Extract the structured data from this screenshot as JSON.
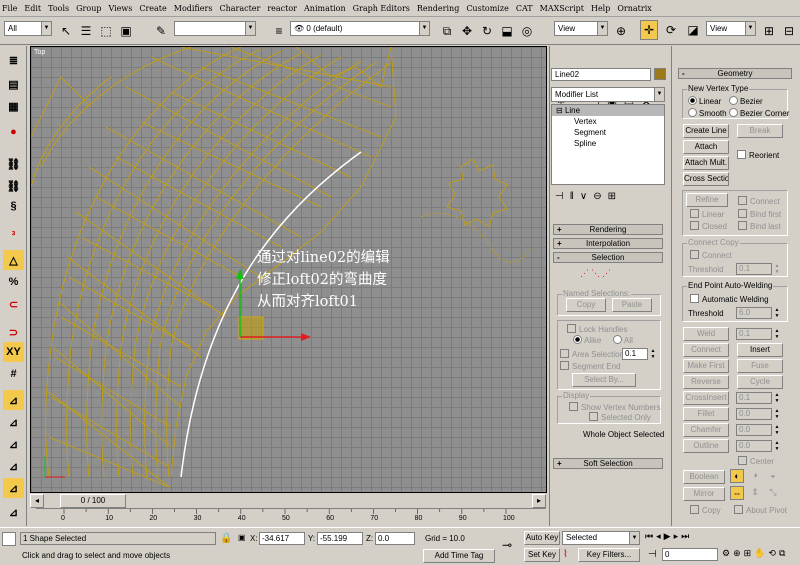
{
  "menu": [
    "File",
    "Edit",
    "Tools",
    "Group",
    "Views",
    "Create",
    "Modifiers",
    "Character",
    "reactor",
    "Animation",
    "Graph Editors",
    "Rendering",
    "Customize",
    "CAT",
    "MAXScript",
    "Help",
    "Ornatrix"
  ],
  "toolbar": {
    "selection_filter": "All",
    "named_selection": "",
    "layer": "0 (default)",
    "ref_coord": "View",
    "ref_coord2": "View",
    "icons": [
      "select-arrow-icon",
      "select-region-icon",
      "window-crossing-icon",
      "select-by-name-icon",
      "link-icon",
      "unlink-icon",
      "bind-icon",
      "layer-icon",
      "move-icon",
      "rotate-icon",
      "scale-icon",
      "pivot-icon",
      "mirror-icon",
      "align-icon"
    ]
  },
  "viewport": {
    "label": "Top",
    "annotation": [
      "通过对line02的编辑",
      "修正loft02的弯曲度",
      "从而对齐loft01"
    ]
  },
  "timeline": {
    "slider_label": "0 / 100",
    "ticks": [
      "0",
      "10",
      "20",
      "30",
      "40",
      "50",
      "60",
      "70",
      "80",
      "90",
      "100"
    ]
  },
  "status": {
    "selected": "1 Shape Selected",
    "prompt": "Click and drag to select and move objects",
    "x_label": "X:",
    "x": "-34.617",
    "y_label": "Y:",
    "y": "-55.199",
    "z_label": "Z:",
    "z": "0.0",
    "grid": "Grid = 10.0",
    "add_time_tag": "Add Time Tag",
    "auto_key": "Auto Key",
    "set_key": "Set Key",
    "key_mode": "Selected",
    "key_filters": "Key Filters...",
    "frame": "0"
  },
  "command_panel": {
    "object_name": "Line02",
    "object_color": "#9c7a1a",
    "modifier_list": "Modifier List",
    "stack": [
      "Line",
      "Vertex",
      "Segment",
      "Spline"
    ],
    "rollouts": {
      "rendering": "Rendering",
      "interpolation": "Interpolation",
      "selection": "Selection",
      "soft_selection": "Soft Selection",
      "geometry": "Geometry"
    },
    "selection": {
      "named_selections": "Named Selections:",
      "copy": "Copy",
      "paste": "Paste",
      "lock_handles": "Lock Handles",
      "alike": "Alike",
      "all": "All",
      "area_selection": "Area Selection:",
      "area_value": "0.1",
      "segment_end": "Segment End",
      "select_by": "Select By...",
      "display": "Display",
      "show_vertex_numbers": "Show Vertex Numbers",
      "selected_only": "Selected Only",
      "whole_object_selected": "Whole Object Selected"
    },
    "geometry": {
      "new_vertex_type": "New Vertex Type",
      "linear": "Linear",
      "bezier": "Bezier",
      "smooth": "Smooth",
      "bezier_corner": "Bezier Corner",
      "create_line": "Create Line",
      "break": "Break",
      "attach": "Attach",
      "reorient": "Reorient",
      "attach_mult": "Attach Mult.",
      "cross_section": "Cross Section",
      "refine": "Refine",
      "connect": "Connect",
      "linear2": "Linear",
      "bind_first": "Bind first",
      "closed": "Closed",
      "bind_last": "Bind last",
      "connect_copy": "Connect Copy",
      "connect2": "Connect",
      "threshold": "Threshold",
      "threshold_val": "0.1",
      "end_point_auto_welding": "End Point Auto-Welding",
      "automatic_welding": "Automatic Welding",
      "threshold2": "Threshold",
      "threshold2_val": "6.0",
      "weld": "Weld",
      "weld_val": "0.1",
      "connect3": "Connect",
      "insert": "Insert",
      "make_first": "Make First",
      "fuse": "Fuse",
      "reverse": "Reverse",
      "cycle": "Cycle",
      "crossinsert": "CrossInsert",
      "crossinsert_val": "0.1",
      "fillet": "Fillet",
      "fillet_val": "0.0",
      "chamfer": "Chamfer",
      "chamfer_val": "0.0",
      "outline": "Outline",
      "outline_val": "0.0",
      "center": "Center",
      "boolean": "Boolean",
      "mirror": "Mirror",
      "copy": "Copy",
      "about_pivot": "About Pivot"
    }
  }
}
